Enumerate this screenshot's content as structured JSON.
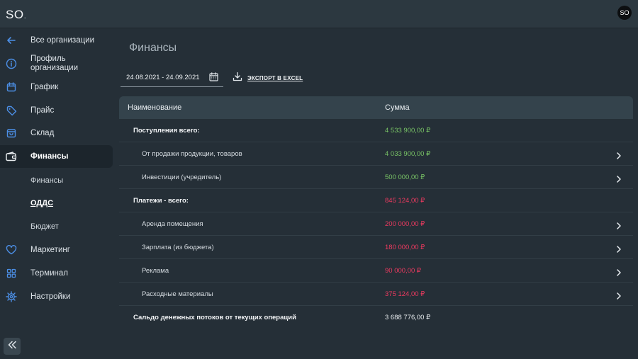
{
  "app": {
    "logo": "SO",
    "logo_dot": ".",
    "user_initials": "SO"
  },
  "sidebar": {
    "items": [
      {
        "label": "Все организации",
        "icon": "arrow-left-icon"
      },
      {
        "label": "Профиль организации",
        "icon": "info-icon"
      },
      {
        "label": "График",
        "icon": "calendar-icon"
      },
      {
        "label": "Прайс",
        "icon": "tag-icon"
      },
      {
        "label": "Склад",
        "icon": "bag-icon"
      },
      {
        "label": "Финансы",
        "icon": "wallet-icon",
        "active": true
      },
      {
        "label": "Маркетинг",
        "icon": "heart-icon"
      },
      {
        "label": "Терминал",
        "icon": "grid-icon"
      },
      {
        "label": "Настройки",
        "icon": "gear-icon"
      }
    ],
    "sub_items": [
      {
        "label": "Финансы"
      },
      {
        "label": "ОДДС",
        "current": true
      },
      {
        "label": "Бюджет"
      }
    ]
  },
  "main": {
    "title": "Финансы",
    "date_range": "24.08.2021 - 24.09.2021",
    "export_label": "ЭКСПОРТ В EXCEL"
  },
  "table": {
    "columns": [
      "Наименование",
      "Сумма"
    ],
    "rows": [
      {
        "name": "Поступления всего:",
        "amount": "4 533 900,00 ₽",
        "level": "total",
        "tone": "pos",
        "expandable": false
      },
      {
        "name": "От продажи продукции, товаров",
        "amount": "4 033 900,00 ₽",
        "level": "child",
        "tone": "pos",
        "expandable": true
      },
      {
        "name": "Инвестиции (учредитель)",
        "amount": "500 000,00 ₽",
        "level": "child",
        "tone": "pos",
        "expandable": true
      },
      {
        "name": "Платежи - всего:",
        "amount": "845 124,00 ₽",
        "level": "total",
        "tone": "neg",
        "expandable": false
      },
      {
        "name": "Аренда помещения",
        "amount": "200 000,00 ₽",
        "level": "child",
        "tone": "neg",
        "expandable": true
      },
      {
        "name": "Зарплата (из бюджета)",
        "amount": "180 000,00 ₽",
        "level": "child",
        "tone": "neg",
        "expandable": true
      },
      {
        "name": "Реклама",
        "amount": "90 000,00 ₽",
        "level": "child",
        "tone": "neg",
        "expandable": true
      },
      {
        "name": "Расходные материалы",
        "amount": "375 124,00 ₽",
        "level": "child",
        "tone": "neg",
        "expandable": true
      },
      {
        "name": "Сальдо денежных потоков от текущих операций",
        "amount": "3 688 776,00 ₽",
        "level": "total",
        "tone": "neutral",
        "expandable": false
      }
    ]
  },
  "colors": {
    "accent": "#4c8fe6",
    "positive": "#79c466",
    "negative": "#ee3a60"
  }
}
